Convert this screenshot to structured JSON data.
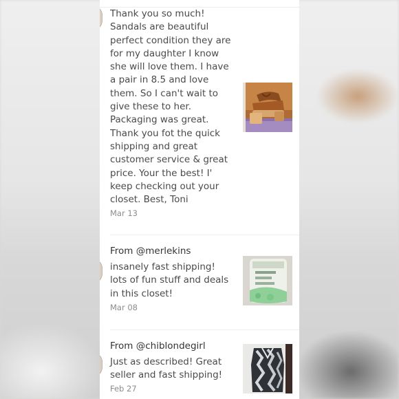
{
  "reviews": [
    {
      "from": "",
      "text": "Thank you so much! Sandals are beautiful perfect condition they are for my daughter I know she will love them. I have a pair in 8.5 and love them. So I can't wait to give these to her. Packaging was great. Thank you fot the quick shipping and great customer service & great price. Your the best! I' keep checking out your closet. Best, Toni",
      "date": "Mar 13",
      "thumb_icon": "sandals-photo"
    },
    {
      "from": "From @merlekins",
      "text": "insanely fast shipping! lots of fun stuff and deals in this closet!",
      "date": "Mar 08",
      "thumb_icon": "body-wipes-package-photo"
    },
    {
      "from": "From @chiblondegirl",
      "text": "Just as described! Great seller and fast shipping!",
      "date": "Feb 27",
      "thumb_icon": "patterned-dress-photo"
    }
  ]
}
